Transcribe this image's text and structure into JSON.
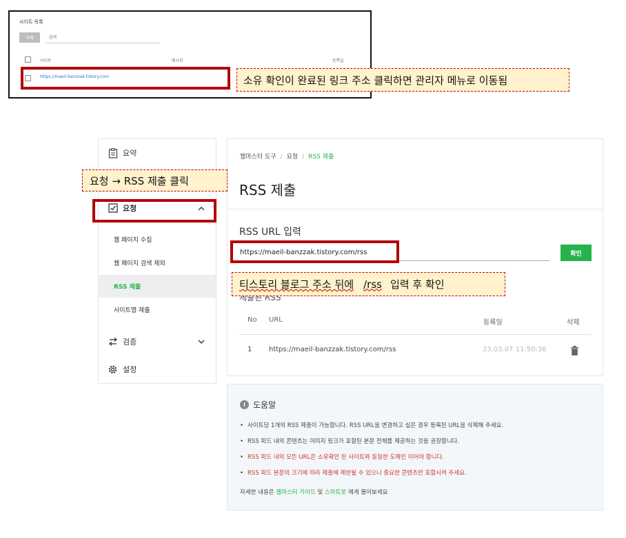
{
  "site_list": {
    "title": "사이트 목록",
    "delete_label": "삭제",
    "search_placeholder": "검색",
    "col_site": "사이트",
    "col_message": "메시지",
    "col_date": "등록일",
    "row_url": "https://maeil-banzzak.tistory.com"
  },
  "callouts": {
    "top": "소유 확인이 완료된 링크 주소 클릭하면 관리자 메뉴로 이동됨",
    "left": "요청 → RSS 제출 클릭",
    "rss": {
      "prefix": "티스토리 블로그 주소 뒤에",
      "code": "/rss",
      "suffix": "입력 후 확인"
    }
  },
  "sidebar": {
    "summary": "요약",
    "request": "요청",
    "request_items": [
      "웹 페이지 수집",
      "웹 페이지 검색 제외",
      "RSS 제출",
      "사이트맵 제출"
    ],
    "verify": "검증",
    "settings": "설정"
  },
  "main": {
    "breadcrumb": [
      "웹마스터 도구",
      "요청",
      "RSS 제출"
    ],
    "title": "RSS 제출",
    "url_label": "RSS URL 입력",
    "url_value": "https://maeil-banzzak.tistory.com/rss",
    "confirm_label": "확인",
    "hidden_sub": "제출된 RSS",
    "table": {
      "headers": [
        "No",
        "URL",
        "등록일",
        "삭제"
      ],
      "rows": [
        {
          "no": "1",
          "url": "https://maeil-banzzak.tistory.com/rss",
          "date": "23.03.07 11:50:36"
        }
      ]
    }
  },
  "help": {
    "title": "도움말",
    "items": [
      "사이트당 1개의 RSS 제출이 가능합니다. RSS URL을 변경하고 싶은 경우 등록된 URL을 삭제해 주세요.",
      "RSS 피드 내의 콘텐츠는 이미지 링크가 포함된 본문 전체를 제공하는 것을 권장합니다.",
      "RSS 피드 내의 모든 URL은 소유확인 된 사이트와 동일한 도메인 이어야 합니다.",
      "RSS 피드 본문의 크기에 따라 제출에 제한될 수 있으니 중요한 콘텐츠만 포함시켜 주세요."
    ],
    "footer_pre": "자세한 내용은",
    "footer_link1": "웹마스터 가이드",
    "footer_mid": "및",
    "footer_link2": "스마트봇",
    "footer_post": "에게 물어보세요"
  },
  "colors": {
    "accent_green": "#27b24b",
    "highlight_red": "#b30000",
    "warning_red": "#d0342c",
    "callout_bg": "#fff2cc"
  }
}
